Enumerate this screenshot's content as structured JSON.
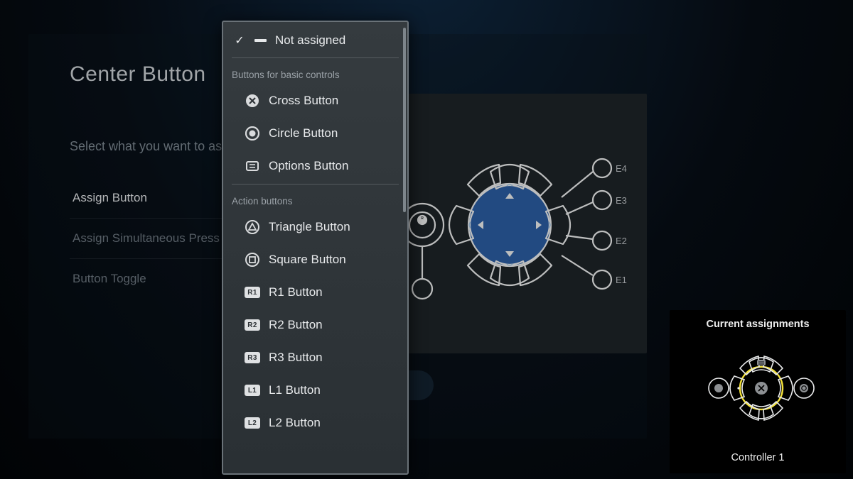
{
  "panel": {
    "title": "Center Button",
    "subtitle": "Select what you want to assign to this button.",
    "menu": [
      {
        "label": "Assign Button",
        "selected": true
      },
      {
        "label": "Assign Simultaneous Press",
        "selected": false
      },
      {
        "label": "Button Toggle",
        "selected": false
      }
    ]
  },
  "controller": {
    "ext_labels": [
      "E4",
      "E3",
      "E2",
      "E1"
    ]
  },
  "dropdown": {
    "selected_label": "Not assigned",
    "group1": "Buttons for basic controls",
    "basic": [
      {
        "icon": "cross-icon",
        "label": "Cross Button"
      },
      {
        "icon": "circle-icon",
        "label": "Circle Button"
      },
      {
        "icon": "options-icon",
        "label": "Options Button"
      }
    ],
    "group2": "Action buttons",
    "action": [
      {
        "icon": "triangle-icon",
        "label": "Triangle Button"
      },
      {
        "icon": "square-icon",
        "label": "Square Button"
      },
      {
        "icon": "r1-badge",
        "label": "R1 Button"
      },
      {
        "icon": "r2-badge",
        "label": "R2 Button"
      },
      {
        "icon": "r3-badge",
        "label": "R3 Button"
      },
      {
        "icon": "l1-badge",
        "label": "L1 Button"
      },
      {
        "icon": "l2-badge",
        "label": "L2 Button"
      }
    ],
    "badge_text": {
      "r1": "R1",
      "r2": "R2",
      "r3": "R3",
      "l1": "L1",
      "l2": "L2"
    }
  },
  "mini": {
    "title": "Current assignments",
    "footer": "Controller 1"
  }
}
